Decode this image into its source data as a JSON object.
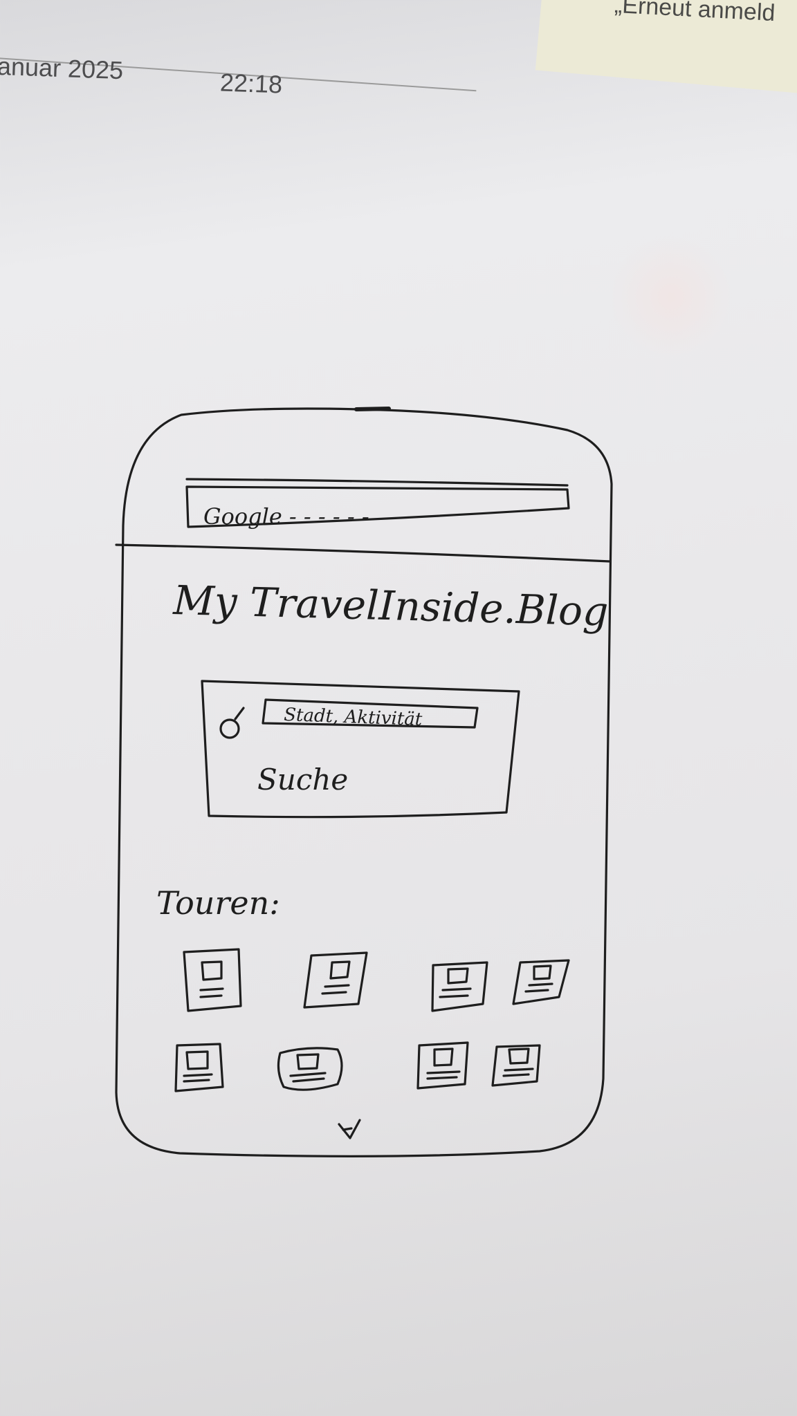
{
  "screen": {
    "notification_text": "„Erneut anmeld",
    "date": "anuar 2025",
    "time": "22:18"
  },
  "sketch": {
    "address_bar": "Google - - - - - -",
    "site_title": "My TravelInside.Blog",
    "search_field": "Stadt, Aktivität",
    "search_button": "Suche",
    "tours_heading": "Touren:",
    "tour_cards_count": 8,
    "icons": {
      "search": "magnifier-icon",
      "scroll_down": "chevron-down-icon",
      "tour_card": "image-card-icon"
    }
  },
  "colors": {
    "ink": "#1e1e1e",
    "paper": "#e9e8ea",
    "banner": "#ecead6"
  }
}
